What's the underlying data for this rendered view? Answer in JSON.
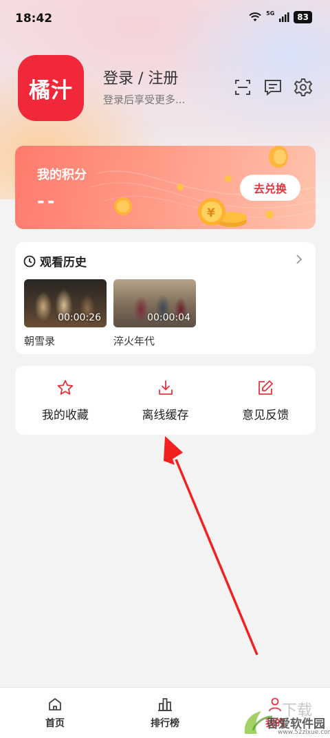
{
  "status_bar": {
    "time": "18:42",
    "network": "5G",
    "battery": "83"
  },
  "profile": {
    "logo_text": "橘汁",
    "login_title": "登录 / 注册",
    "login_subtitle": "登录后享受更多..."
  },
  "icons": {
    "scan": "scan-icon",
    "message": "message-icon",
    "settings": "gear-icon",
    "clock": "clock-icon",
    "chevron": "chevron-right-icon",
    "favorites": "star-icon",
    "downloads": "download-icon",
    "feedback": "edit-icon",
    "home": "home-icon",
    "ranking": "bar-chart-icon",
    "mine": "person-icon"
  },
  "points": {
    "label": "我的积分",
    "value": "--",
    "redeem_button": "去兑换"
  },
  "history": {
    "title": "观看历史",
    "items": [
      {
        "title": "朝雪录",
        "duration": "00:00:26"
      },
      {
        "title": "淬火年代",
        "duration": "00:00:04"
      }
    ]
  },
  "tools": [
    {
      "label": "我的收藏"
    },
    {
      "label": "离线缓存"
    },
    {
      "label": "意见反馈"
    }
  ],
  "bottom_nav": [
    {
      "label": "首页"
    },
    {
      "label": "排行榜"
    },
    {
      "label": "我的"
    }
  ],
  "watermark": {
    "text": "吾爱软件园",
    "url": "www.52zixue.com"
  },
  "colors": {
    "brand_red": "#f0283a",
    "accent_red": "#e8323d",
    "annotation_arrow": "#f32020"
  }
}
